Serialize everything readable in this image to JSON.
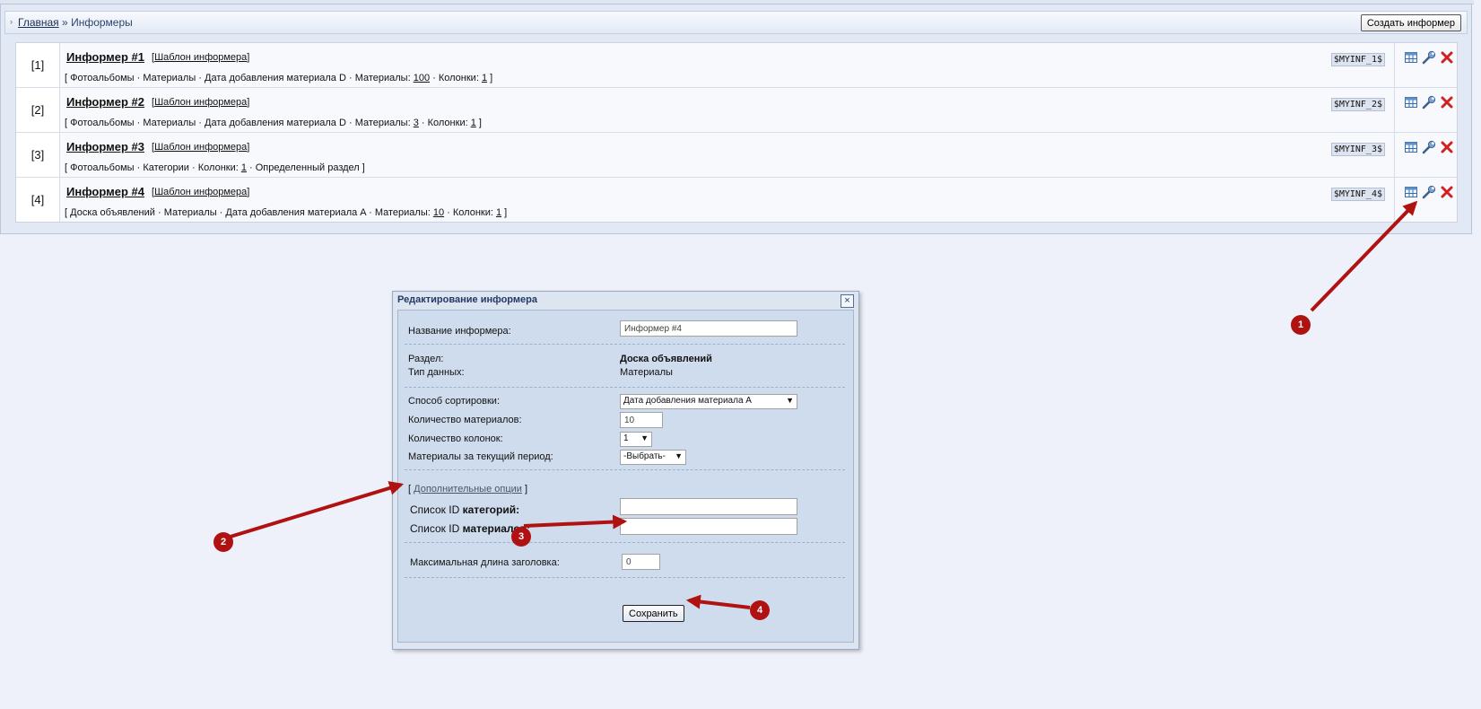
{
  "breadcrumb": {
    "home": "Главная",
    "separator": "»",
    "current": "Информеры"
  },
  "toolbar": {
    "create_label": "Создать информер"
  },
  "informers": [
    {
      "num": "[1]",
      "title": "Информер #1",
      "template_label": "Шаблон информера",
      "details": [
        "Фотоальбомы",
        "Материалы",
        "Дата добавления материала D",
        "Материалы: ",
        "100",
        "Колонки: ",
        "1"
      ],
      "code": "$MYINF_1$"
    },
    {
      "num": "[2]",
      "title": "Информер #2",
      "template_label": "Шаблон информера",
      "details": [
        "Фотоальбомы",
        "Материалы",
        "Дата добавления материала D",
        "Материалы: ",
        "3",
        "Колонки: ",
        "1"
      ],
      "code": "$MYINF_2$"
    },
    {
      "num": "[3]",
      "title": "Информер #3",
      "template_label": "Шаблон информера",
      "details": [
        "Фотоальбомы",
        "Категории",
        "Колонки: ",
        "1",
        "Определенный раздел"
      ],
      "code": "$MYINF_3$"
    },
    {
      "num": "[4]",
      "title": "Информер #4",
      "template_label": "Шаблон информера",
      "details": [
        "Доска объявлений",
        "Материалы",
        "Дата добавления материала A",
        "Материалы: ",
        "10",
        "Колонки: ",
        "1"
      ],
      "code": "$MYINF_4$"
    }
  ],
  "dialog": {
    "title": "Редактирование информера",
    "close": "×",
    "name_label": "Название информера:",
    "name_value": "Информер #4",
    "section_label": "Раздел:",
    "section_value": "Доска объявлений",
    "datatype_label": "Тип данных:",
    "datatype_value": "Материалы",
    "sort_label": "Способ сортировки:",
    "sort_value": "Дата добавления материала A",
    "count_label": "Количество материалов:",
    "count_value": "10",
    "columns_label": "Количество колонок:",
    "columns_value": "1",
    "period_label": "Материалы за текущий период:",
    "period_value": "-Выбрать-",
    "advanced_open": "[",
    "advanced_label": "Дополнительные опции",
    "advanced_close": "]",
    "cat_ids_prefix": "Список ID ",
    "cat_ids_bold": "категорий:",
    "mat_ids_prefix": "Список ID ",
    "mat_ids_bold": "материалов:",
    "cat_ids_value": "",
    "mat_ids_value": "",
    "maxlen_label": "Максимальная длина заголовка:",
    "maxlen_value": "0",
    "save_label": "Сохранить"
  },
  "annotations": [
    "1",
    "2",
    "3",
    "4"
  ],
  "colors": {
    "annotation": "#b01212",
    "background": "#eef1f9",
    "dialog_body": "#cfdced"
  },
  "icons": {
    "row_actions": [
      "table-icon",
      "wrench-icon",
      "delete-icon"
    ]
  }
}
